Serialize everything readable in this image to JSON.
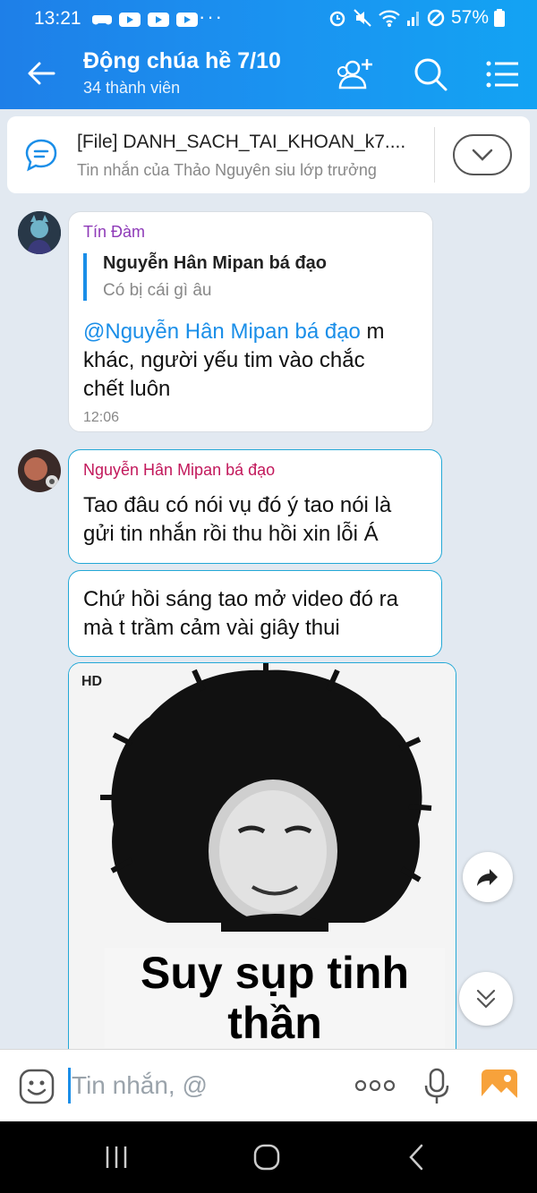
{
  "status_bar": {
    "time": "13:21",
    "dots": "···",
    "battery": "57%"
  },
  "header": {
    "title": "Động chúa hề 7/10",
    "subtitle": "34 thành viên"
  },
  "pinned": {
    "title": "[File] DANH_SACH_TAI_KHOAN_k7....",
    "subtitle": "Tin nhắn của Thảo Nguyên siu lớp trưởng"
  },
  "messages": [
    {
      "sender": "Tín Đàm",
      "quote_name": "Nguyễn Hân Mipan bá đạo",
      "quote_text": "Có bị cái gì âu",
      "mention": "@Nguyễn Hân Mipan bá đạo",
      "text_line1_rest": " m",
      "text_line2": "khác, người yếu tim vào chắc",
      "text_line3": "chết luôn",
      "time": "12:06"
    },
    {
      "sender": "Nguyễn Hân Mipan bá đạo",
      "line1": "Tao đâu có nói vụ đó ý tao nói là",
      "line2": "gửi tin nhắn rồi thu hồi xin lỗi Á"
    },
    {
      "line1": "Chứ hồi sáng tao mở video đó ra",
      "line2": "mà t trầm cảm vài giây thui"
    }
  ],
  "image_message": {
    "badge": "HD",
    "caption_line1": "Suy sụp tinh",
    "caption_line2": "thần"
  },
  "input": {
    "placeholder": "Tin nhắn, @"
  },
  "colors": {
    "header_blue": "#1a8ee8",
    "mention": "#1a8ee8",
    "sender_1": "#8e3ab8",
    "sender_2": "#c2185b",
    "my_border": "#23a8d6"
  }
}
